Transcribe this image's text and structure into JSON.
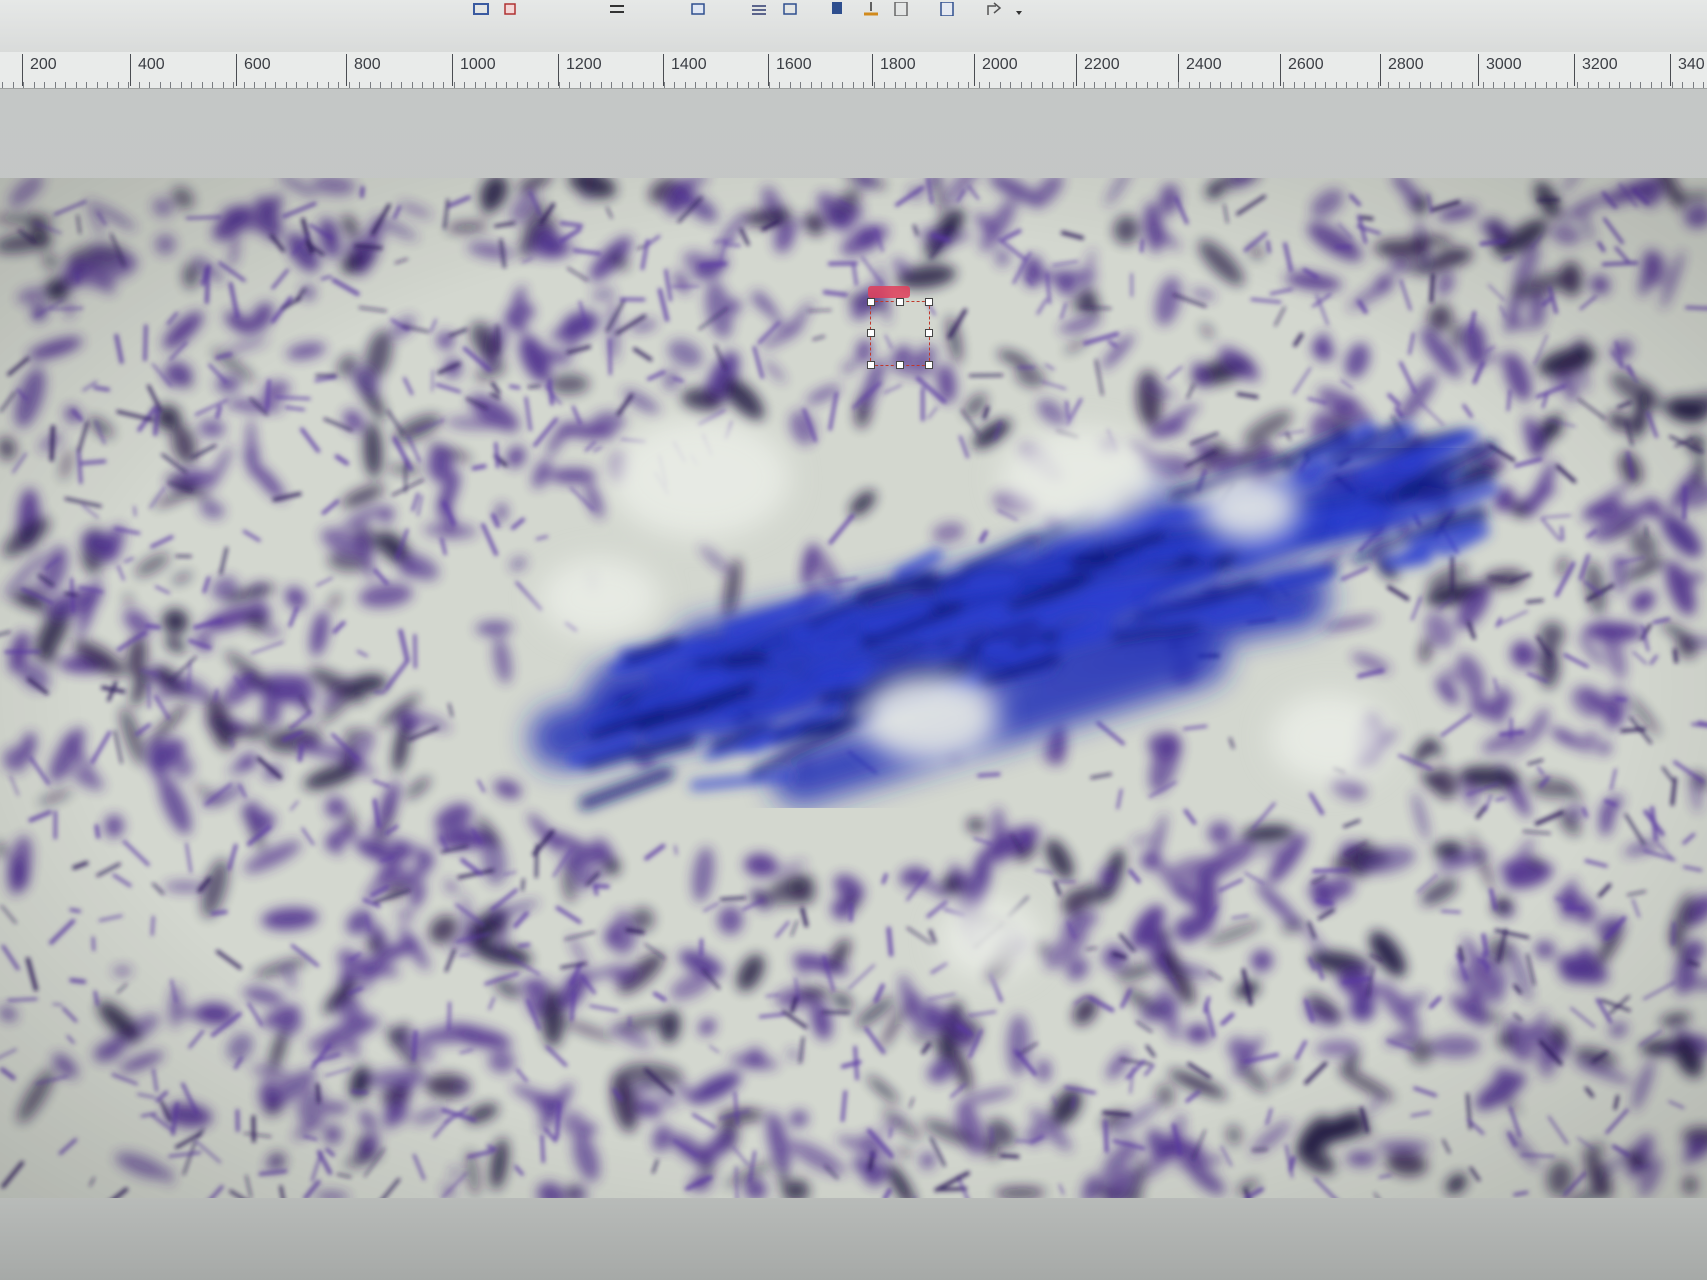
{
  "toolbar": {
    "icons": [
      "align-icon",
      "image-icon",
      "adjust-icon",
      "chart-icon",
      "ruler-icon",
      "layers-icon",
      "export-icon",
      "document-icon",
      "share-icon",
      "dropdown-arrow-icon"
    ]
  },
  "ruler": {
    "labels": [
      "200",
      "400",
      "600",
      "800",
      "1000",
      "1200",
      "1400",
      "1600",
      "1800",
      "2000",
      "2200",
      "2400",
      "2600",
      "2800",
      "3000",
      "3200",
      "340"
    ]
  },
  "colors": {
    "stain_purple": "#4a2a8c",
    "stain_blue": "#1f2fb8",
    "background_tissue": "#d5d8cf",
    "selection": "#c0392b"
  }
}
